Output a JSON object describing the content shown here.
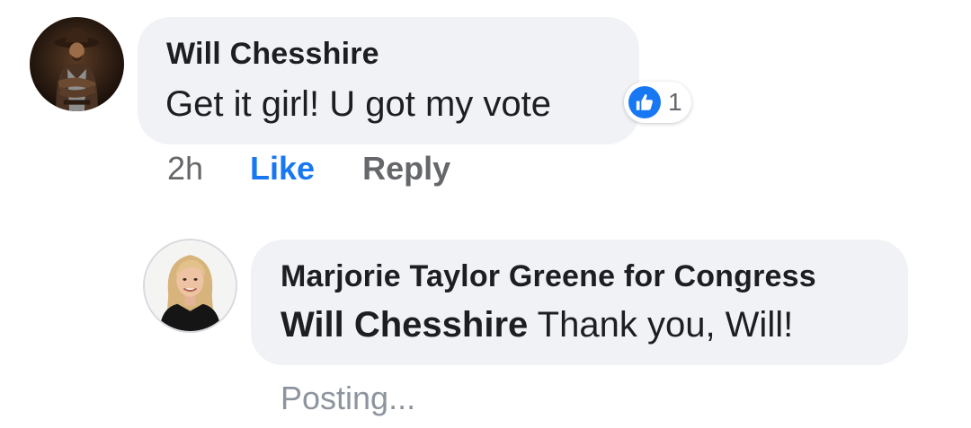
{
  "comment": {
    "author": "Will Chesshire",
    "text": "Get it girl! U got my vote",
    "reaction": {
      "icon": "like-icon",
      "count": "1",
      "color": "#1877f2"
    },
    "actions": {
      "time": "2h",
      "like": "Like",
      "reply": "Reply"
    }
  },
  "reply": {
    "author": "Marjorie Taylor Greene for Congress",
    "mention": "Will Chesshire",
    "text": " Thank you, Will!",
    "status": "Posting..."
  },
  "colors": {
    "bubble": "#f0f2f5",
    "accent": "#1877f2",
    "muted": "#65676b"
  }
}
